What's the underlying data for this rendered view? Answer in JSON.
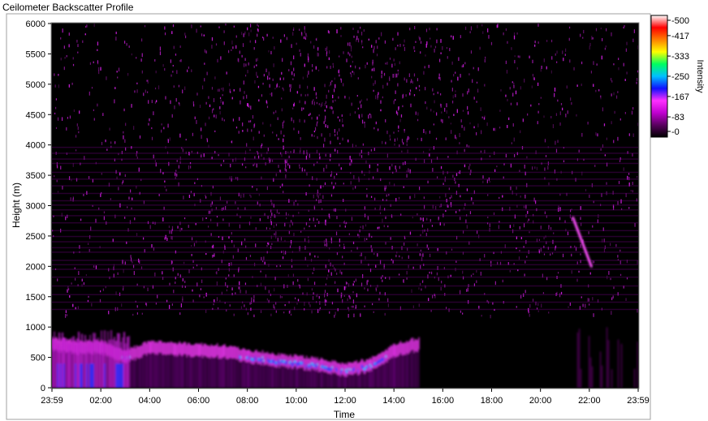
{
  "window": {
    "title": "Ceilometer Backscatter Profile"
  },
  "chart_data": {
    "type": "heatmap",
    "title": "Ceilometer Backscatter Profile",
    "xlabel": "Time",
    "ylabel": "Height (m)",
    "colorbar_label": "Intensity",
    "x_ticks": [
      "23:59",
      "02:00",
      "04:00",
      "06:00",
      "08:00",
      "10:00",
      "12:00",
      "14:00",
      "16:00",
      "18:00",
      "20:00",
      "22:00",
      "23:59"
    ],
    "y_ticks": [
      0,
      500,
      1000,
      1500,
      2000,
      2500,
      3000,
      3500,
      4000,
      4500,
      5000,
      5500,
      6000
    ],
    "ylim": [
      0,
      6000
    ],
    "colorbar_ticks": [
      0,
      83,
      167,
      250,
      333,
      417,
      500
    ],
    "colorbar_range": [
      0,
      500
    ],
    "colorscale": [
      "#000000",
      "#5a0060",
      "#c000d0",
      "#ff30ff",
      "#1010ff",
      "#00c0ff",
      "#00ff60",
      "#ffff00",
      "#ff8000",
      "#ff0000",
      "#ffffff"
    ],
    "features": {
      "boundary_layer_height_m": [
        {
          "time": "00:00",
          "height": 700
        },
        {
          "time": "01:00",
          "height": 650
        },
        {
          "time": "02:00",
          "height": 650
        },
        {
          "time": "03:00",
          "height": 500
        },
        {
          "time": "04:00",
          "height": 650
        },
        {
          "time": "05:00",
          "height": 620
        },
        {
          "time": "06:00",
          "height": 600
        },
        {
          "time": "07:00",
          "height": 580
        },
        {
          "time": "08:00",
          "height": 500
        },
        {
          "time": "09:00",
          "height": 450
        },
        {
          "time": "10:00",
          "height": 400
        },
        {
          "time": "11:00",
          "height": 350
        },
        {
          "time": "12:00",
          "height": 280
        },
        {
          "time": "13:00",
          "height": 350
        },
        {
          "time": "14:00",
          "height": 600
        },
        {
          "time": "15:00",
          "height": 700
        }
      ],
      "descending_layer": [
        {
          "time": "21:20",
          "height": 2800
        },
        {
          "time": "22:05",
          "height": 2000
        }
      ],
      "noise_max_height_m": 6000
    }
  }
}
